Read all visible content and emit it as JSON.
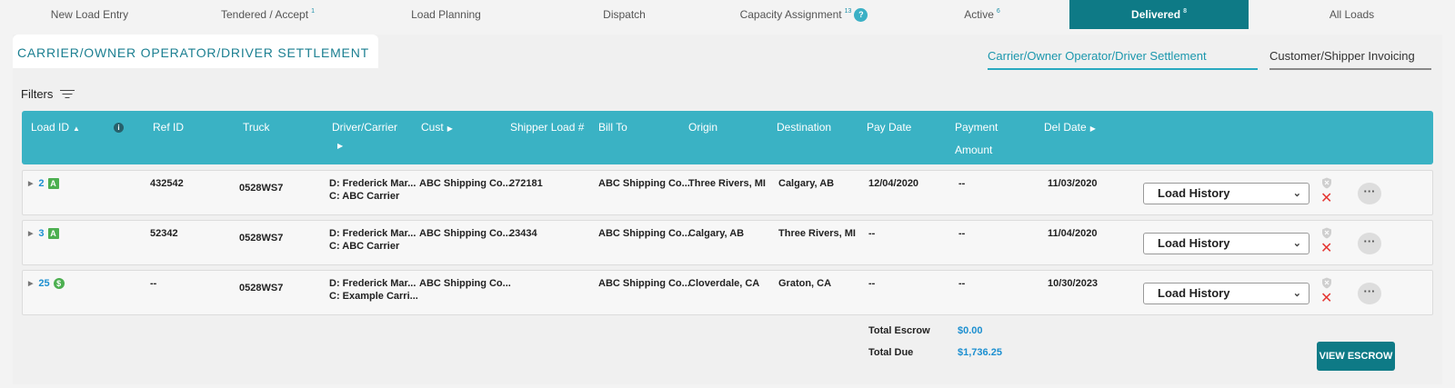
{
  "topnav": [
    {
      "label": "New Load Entry",
      "count": "",
      "active": false
    },
    {
      "label": "Tendered / Accept",
      "count": "1",
      "active": false
    },
    {
      "label": "Load Planning",
      "count": "",
      "active": false
    },
    {
      "label": "Dispatch",
      "count": "",
      "active": false
    },
    {
      "label": "Capacity Assignment",
      "count": "13",
      "active": false,
      "help": "?"
    },
    {
      "label": "Active",
      "count": "6",
      "active": false
    },
    {
      "label": "Delivered",
      "count": "8",
      "active": true
    },
    {
      "label": "All Loads",
      "count": "",
      "active": false
    }
  ],
  "page": {
    "title": "CARRIER/OWNER OPERATOR/DRIVER SETTLEMENT",
    "subtabs": [
      "Carrier/Owner Operator/Driver Settlement",
      "Customer/Shipper Invoicing"
    ],
    "filters_label": "Filters"
  },
  "table": {
    "headers": {
      "load_id": "Load ID",
      "ref_id": "Ref ID",
      "truck": "Truck",
      "driver": "Driver/Carrier",
      "cust": "Cust",
      "shipper_load": "Shipper Load #",
      "bill_to": "Bill To",
      "origin": "Origin",
      "destination": "Destination",
      "pay_date": "Pay Date",
      "payment_amount_1": "Payment",
      "payment_amount_2": "Amount",
      "del_date": "Del Date"
    },
    "rows": [
      {
        "load_id": "2",
        "badge": "A",
        "ref_id": "432542",
        "truck": "0528WS7",
        "driver": "D: Frederick Mar...",
        "carrier": "C: ABC Carrier",
        "cust": "ABC Shipping Co...",
        "shipper_load": "272181",
        "bill_to": "ABC Shipping Co...",
        "origin": "Three Rivers, MI",
        "destination": "Calgary, AB",
        "pay_date": "12/04/2020",
        "payment": "--",
        "del_date": "11/03/2020",
        "action": "Load History"
      },
      {
        "load_id": "3",
        "badge": "A",
        "ref_id": "52342",
        "truck": "0528WS7",
        "driver": "D: Frederick Mar...",
        "carrier": "C: ABC Carrier",
        "cust": "ABC Shipping Co...",
        "shipper_load": "23434",
        "bill_to": "ABC Shipping Co...",
        "origin": "Calgary, AB",
        "destination": "Three Rivers, MI",
        "pay_date": "--",
        "payment": "--",
        "del_date": "11/04/2020",
        "action": "Load History"
      },
      {
        "load_id": "25",
        "badge": "$",
        "ref_id": "--",
        "truck": "0528WS7",
        "driver": "D: Frederick Mar...",
        "carrier": "C: Example Carri...",
        "cust": "ABC Shipping Co...",
        "shipper_load": "",
        "bill_to": "ABC Shipping Co...",
        "origin": "Cloverdale, CA",
        "destination": "Graton, CA",
        "pay_date": "--",
        "payment": "--",
        "del_date": "10/30/2023",
        "action": "Load History"
      }
    ]
  },
  "totals": {
    "escrow_label": "Total Escrow",
    "escrow_value": "$0.00",
    "due_label": "Total Due",
    "due_value": "$1,736.25"
  },
  "buttons": {
    "view_escrow": "VIEW ESCROW"
  }
}
